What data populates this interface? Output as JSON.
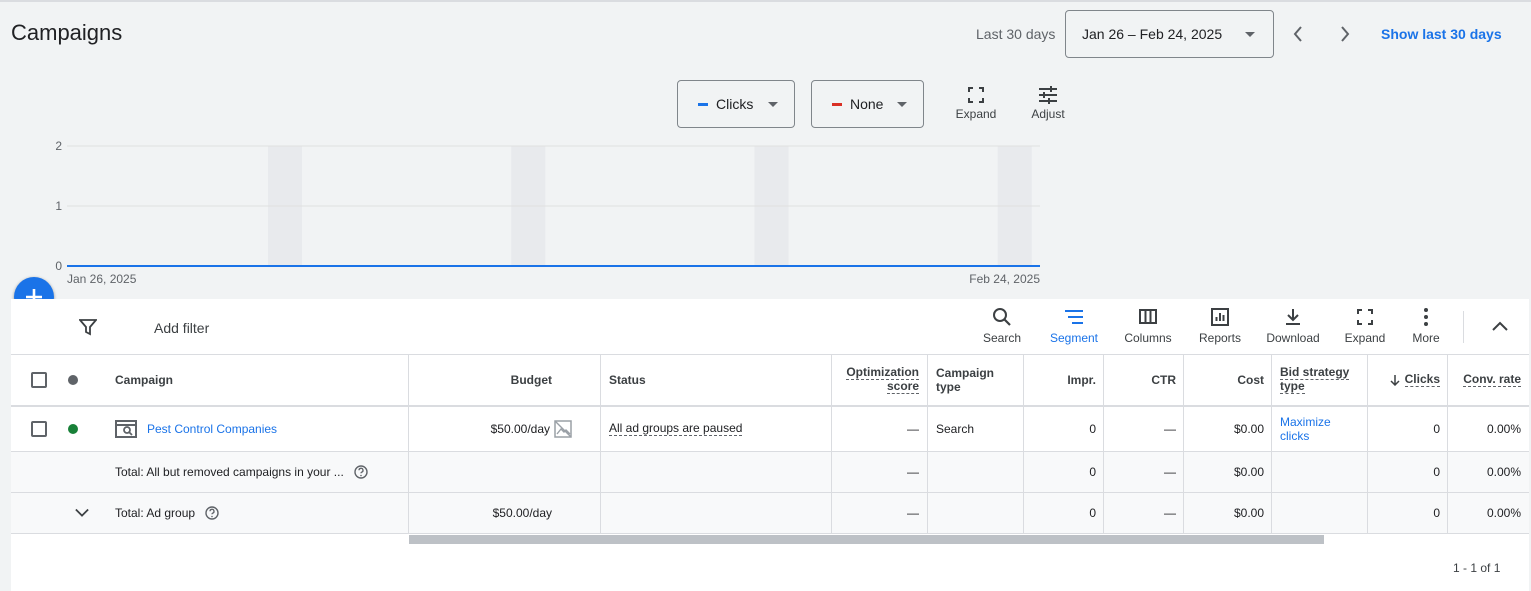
{
  "page": {
    "title": "Campaigns"
  },
  "date_range": {
    "label": "Last 30 days",
    "value": "Jan 26 – Feb 24, 2025",
    "show_last": "Show last 30 days"
  },
  "metrics": {
    "primary": {
      "label": "Clicks",
      "color": "#1a73e8"
    },
    "secondary": {
      "label": "None",
      "color": "#d93025"
    }
  },
  "chart_tools": {
    "expand": "Expand",
    "adjust": "Adjust"
  },
  "chart_data": {
    "type": "line",
    "x_start": "Jan 26, 2025",
    "x_end": "Feb 24, 2025",
    "y_ticks": [
      "0",
      "1",
      "2"
    ],
    "ylim": [
      0,
      2
    ],
    "series": [
      {
        "name": "Clicks",
        "values": [
          0,
          0
        ]
      }
    ],
    "weekend_bands": 4,
    "grid": true
  },
  "filter": {
    "add_filter": "Add filter"
  },
  "toolbar": {
    "search": "Search",
    "segment": "Segment",
    "columns": "Columns",
    "reports": "Reports",
    "download": "Download",
    "expand": "Expand",
    "more": "More"
  },
  "table": {
    "headers": {
      "campaign": "Campaign",
      "budget": "Budget",
      "status": "Status",
      "opt_1": "Optimization",
      "opt_2": "score",
      "type_1": "Campaign",
      "type_2": "type",
      "impr": "Impr.",
      "ctr": "CTR",
      "cost": "Cost",
      "bid_1": "Bid strategy",
      "bid_2": "type",
      "clicks": "Clicks",
      "conv": "Conv. rate"
    },
    "row": {
      "campaign": "Pest Control Companies",
      "budget": "$50.00/day",
      "status": "All ad groups are paused",
      "opt": "—",
      "type": "Search",
      "impr": "0",
      "ctr": "—",
      "cost": "$0.00",
      "bid_1": "Maximize",
      "bid_2": "clicks",
      "clicks": "0",
      "conv": "0.00%"
    },
    "total1": {
      "label": "Total: All but removed campaigns in your ...",
      "opt": "—",
      "impr": "0",
      "ctr": "—",
      "cost": "$0.00",
      "clicks": "0",
      "conv": "0.00%"
    },
    "total2": {
      "label": "Total: Ad group",
      "budget": "$50.00/day",
      "opt": "—",
      "impr": "0",
      "ctr": "—",
      "cost": "$0.00",
      "clicks": "0",
      "conv": "0.00%"
    }
  },
  "pagination": "1 - 1 of 1"
}
